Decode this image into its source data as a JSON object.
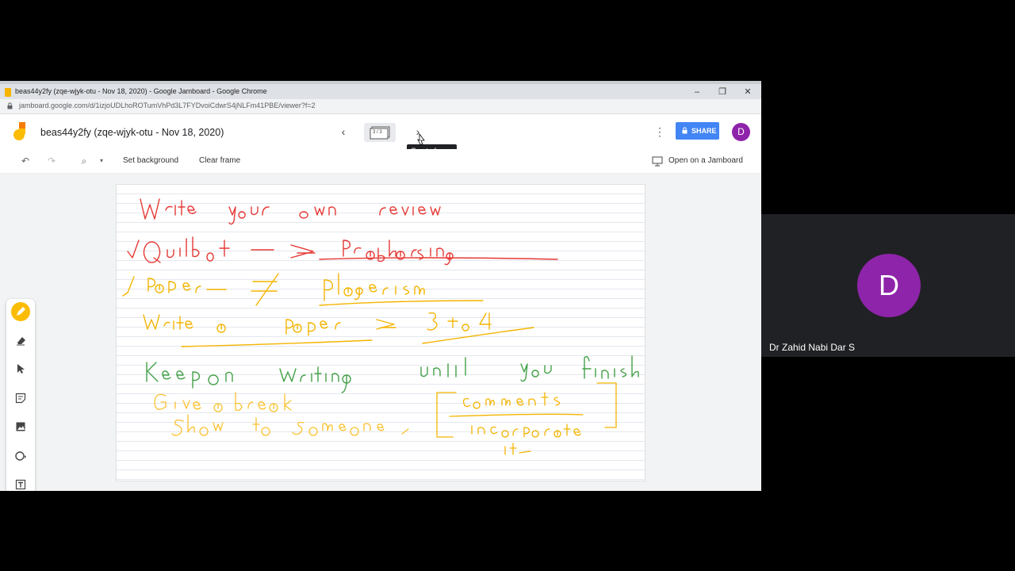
{
  "window": {
    "title": "beas44y2fy (zqe-wjyk-otu - Nov 18, 2020) - Google Jamboard - Google Chrome",
    "url": "jamboard.google.com/d/1izjoUDLhoROTumVhPd3L7FYDvoiCdwrS4jNLFm41PBE/viewer?f=2",
    "minimize_label": "–",
    "restore_label": "❐",
    "close_label": "✕"
  },
  "app": {
    "doc_title": "beas44y2fy (zqe-wjyk-otu - Nov 18, 2020)",
    "frame_counter": "3 / 3",
    "prev_glyph": "‹",
    "next_glyph": "›",
    "tooltip": "Create frame",
    "more_glyph": "⋮",
    "share_label": "SHARE",
    "avatar_initial": "D"
  },
  "toolbar": {
    "undo_glyph": "↶",
    "redo_glyph": "↷",
    "zoom_glyph": "⌕",
    "zoom_dropdown_glyph": "▾",
    "set_background": "Set background",
    "clear_frame": "Clear frame",
    "open_on_jamboard": "Open on a Jamboard"
  },
  "sidebar": {
    "tools": [
      "pen-icon",
      "eraser-icon",
      "select-icon",
      "sticky-note-icon",
      "image-icon",
      "circle-icon",
      "text-box-icon",
      "laser-icon"
    ],
    "active_tool": "pen-icon"
  },
  "board": {
    "background": "lined",
    "handwriting_colors": {
      "red": "#e53935",
      "orange": "#f4b400",
      "green": "#43a047",
      "yellow": "#fbc02d"
    },
    "lines": [
      "Write your own review",
      "Quilbot → Paraphrasing",
      "paper ≠ plagerism",
      "Write a paper → 3 to 4",
      "Keep on writing until you finish",
      "Give a break",
      "Show to someone",
      "comments",
      "incorporate it"
    ]
  },
  "participant": {
    "initial": "D",
    "name": "Dr Zahid Nabi Dar S",
    "avatar_color": "#8e24aa"
  }
}
